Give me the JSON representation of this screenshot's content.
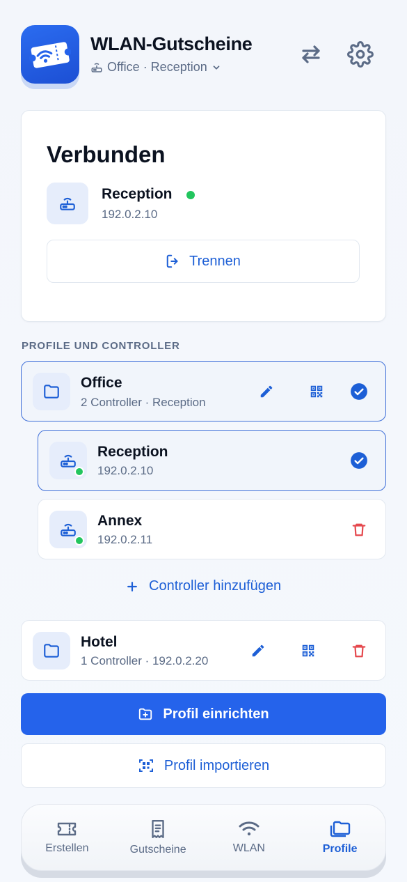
{
  "header": {
    "title": "WLAN-Gutscheine",
    "subtitle": "Office · Reception"
  },
  "connection": {
    "status_title": "Verbunden",
    "controller_name": "Reception",
    "controller_ip": "192.0.2.10",
    "disconnect_label": "Trennen"
  },
  "section_label": "PROFILE UND CONTROLLER",
  "profiles": [
    {
      "name": "Office",
      "detail": "2 Controller · Reception",
      "controllers": [
        {
          "name": "Reception",
          "ip": "192.0.2.10"
        },
        {
          "name": "Annex",
          "ip": "192.0.2.11"
        }
      ],
      "add_controller_label": "Controller hinzufügen"
    },
    {
      "name": "Hotel",
      "detail": "1 Controller · 192.0.2.20"
    }
  ],
  "actions": {
    "setup_profile": "Profil einrichten",
    "import_profile": "Profil importieren"
  },
  "tabs": [
    {
      "label": "Erstellen"
    },
    {
      "label": "Gutscheine"
    },
    {
      "label": "WLAN"
    },
    {
      "label": "Profile"
    }
  ],
  "colors": {
    "accent": "#2563eb",
    "online": "#22c55e",
    "danger": "#e5484d"
  }
}
